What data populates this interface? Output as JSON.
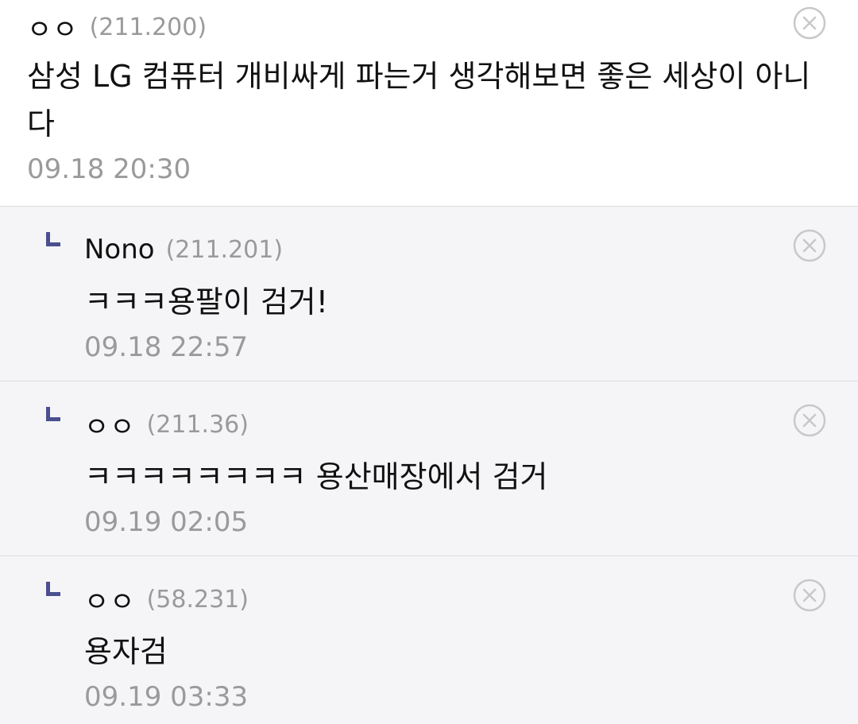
{
  "comments": [
    {
      "author": "ㅇㅇ",
      "ip": "(211.200)",
      "text": "삼성 LG 컴퓨터 개비싸게 파는거 생각해보면 좋은 세상이 아니다",
      "time": "09.18 20:30"
    },
    {
      "author": "Nono",
      "ip": "(211.201)",
      "text": "ㅋㅋㅋ용팔이 검거!",
      "time": "09.18 22:57"
    },
    {
      "author": "ㅇㅇ",
      "ip": "(211.36)",
      "text": "ㅋㅋㅋㅋㅋㅋㅋㅋ 용산매장에서 검거",
      "time": "09.19 02:05"
    },
    {
      "author": "ㅇㅇ",
      "ip": "(58.231)",
      "text": "용자검",
      "time": "09.19 03:33"
    }
  ],
  "icons": {
    "delete": "close-circle-icon",
    "reply": "reply-arrow-icon"
  },
  "colors": {
    "reply_background": "#f5f5f7",
    "muted_text": "#9a9a9a",
    "reply_marker": "#4a4f8f"
  }
}
